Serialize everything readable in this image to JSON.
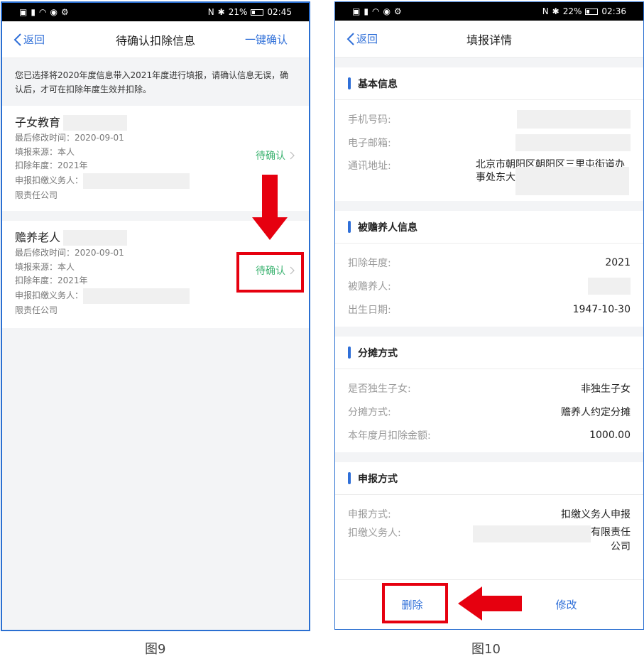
{
  "screen1": {
    "status": {
      "time": "02:45",
      "battery": "21%"
    },
    "nav": {
      "back": "返回",
      "title": "待确认扣除信息",
      "action": "一键确认"
    },
    "notice": "您已选择将2020年度信息带入2021年度进行填报，请确认信息无误，确认后，才可在扣除年度生效并扣除。",
    "cards": [
      {
        "title": "子女教育",
        "modified": "最后修改时间：2020-09-01",
        "source": "填报来源：本人",
        "year": "扣除年度：2021年",
        "agent_label": "申报扣缴义务人：",
        "agent_suffix": "限责任公司",
        "status": "待确认"
      },
      {
        "title": "赡养老人",
        "modified": "最后修改时间：2020-09-01",
        "source": "填报来源：本人",
        "year": "扣除年度：2021年",
        "agent_label": "申报扣缴义务人：",
        "agent_suffix": "限责任公司",
        "status": "待确认"
      }
    ],
    "caption": "图9"
  },
  "screen2": {
    "status": {
      "time": "02:36",
      "battery": "22%"
    },
    "nav": {
      "back": "返回",
      "title": "填报详情"
    },
    "basic": {
      "title": "基本信息",
      "phone_label": "手机号码:",
      "email_label": "电子邮箱:",
      "address_label": "通讯地址:",
      "address_line1": "北京市朝阳区朝阳区三里屯街道办",
      "address_line2": "事处东大"
    },
    "supported": {
      "title": "被赡养人信息",
      "year_label": "扣除年度:",
      "year_value": "2021",
      "name_label": "被赡养人:",
      "birth_label": "出生日期:",
      "birth_value": "1947-10-30"
    },
    "share": {
      "title": "分摊方式",
      "only_child_label": "是否独生子女:",
      "only_child_value": "非独生子女",
      "method_label": "分摊方式:",
      "method_value": "赡养人约定分摊",
      "amount_label": "本年度月扣除金额:",
      "amount_value": "1000.00"
    },
    "declare": {
      "title": "申报方式",
      "method_label": "申报方式:",
      "method_value": "扣缴义务人申报",
      "agent_label": "扣缴义务人:",
      "agent_value_line1": "有限责任",
      "agent_value_line2": "公司"
    },
    "buttons": {
      "delete": "删除",
      "edit": "修改"
    },
    "caption": "图10"
  },
  "colors": {
    "accent": "#2f6fd8",
    "pending": "#3cb371",
    "highlight": "#e6000f"
  }
}
